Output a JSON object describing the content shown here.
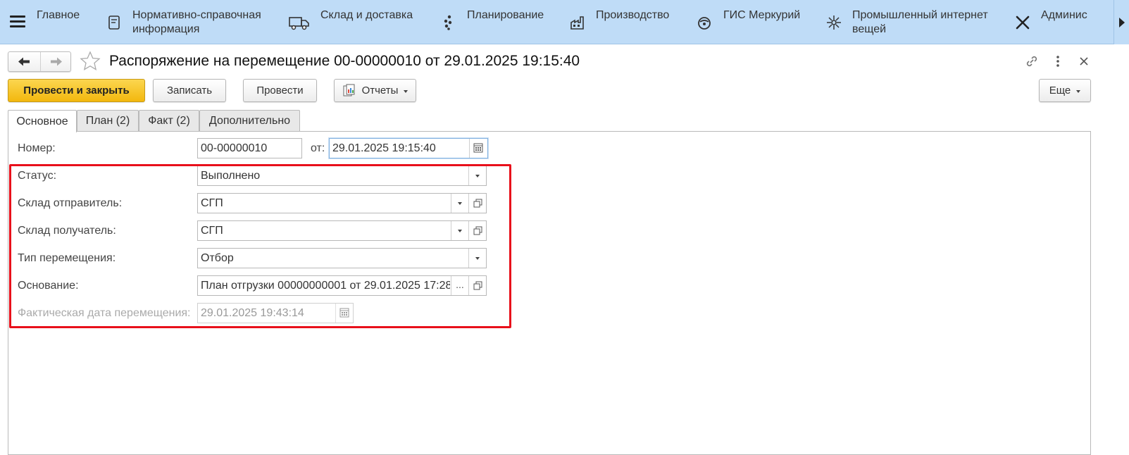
{
  "sections": [
    {
      "label": "Главное",
      "icon": "menu-icon"
    },
    {
      "label": "Нормативно-справочная\nинформация",
      "icon": "book-icon"
    },
    {
      "label": "Склад и доставка",
      "icon": "truck-icon"
    },
    {
      "label": "Планирование",
      "icon": "dots-icon"
    },
    {
      "label": "Производство",
      "icon": "factory-icon"
    },
    {
      "label": "ГИС Меркурий",
      "icon": "mercury-icon"
    },
    {
      "label": "Промышленный интернет\nвещей",
      "icon": "iot-icon"
    },
    {
      "label": "Админис",
      "icon": "tools-icon"
    }
  ],
  "header": {
    "title": "Распоряжение на перемещение 00-00000010 от 29.01.2025 19:15:40"
  },
  "toolbar": {
    "post_close": "Провести и закрыть",
    "save": "Записать",
    "post": "Провести",
    "reports": "Отчеты",
    "more": "Еще"
  },
  "tabs": [
    {
      "label": "Основное",
      "active": true
    },
    {
      "label": "План (2)",
      "active": false
    },
    {
      "label": "Факт (2)",
      "active": false
    },
    {
      "label": "Дополнительно",
      "active": false
    }
  ],
  "form": {
    "number_label": "Номер:",
    "number_value": "00-00000010",
    "from_label": "от:",
    "date_value": "29.01.2025 19:15:40",
    "status_label": "Статус:",
    "status_value": "Выполнено",
    "sender_label": "Склад отправитель:",
    "sender_value": "СГП",
    "receiver_label": "Склад получатель:",
    "receiver_value": "СГП",
    "type_label": "Тип перемещения:",
    "type_value": "Отбор",
    "basis_label": "Основание:",
    "basis_value": "План отгрузки 00000000001 от 29.01.2025 17:28",
    "basis_ellipsis": "...",
    "actual_date_label": "Фактическая дата перемещения:",
    "actual_date_value": "29.01.2025 19:43:14"
  },
  "colors": {
    "section_bar": "#bfdcf7",
    "primary_button": "#f5c022",
    "highlight_box": "#e8101b"
  }
}
